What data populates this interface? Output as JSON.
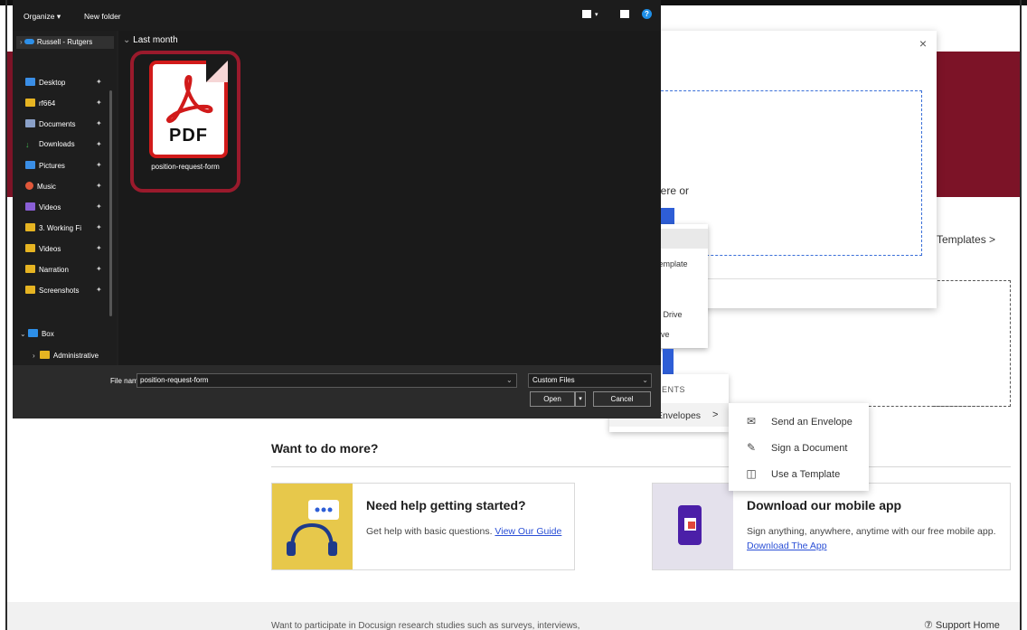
{
  "dialog": {
    "toolbar": {
      "organize_label": "Organize ▾",
      "new_folder_label": "New folder"
    },
    "nav": {
      "top_item": "Russell - Rutgers",
      "quick_access": [
        {
          "label": "Desktop",
          "icon": "desktop-icon",
          "color": "#3a8ee6"
        },
        {
          "label": "rf664",
          "icon": "folder-icon",
          "color": "#e6b422"
        },
        {
          "label": "Documents",
          "icon": "documents-icon",
          "color": "#8aa0c8"
        },
        {
          "label": "Downloads",
          "icon": "downloads-icon",
          "color": "#3fb14f"
        },
        {
          "label": "Pictures",
          "icon": "pictures-icon",
          "color": "#3a8ee6"
        },
        {
          "label": "Music",
          "icon": "music-icon",
          "color": "#e0573a"
        },
        {
          "label": "Videos",
          "icon": "videos-icon",
          "color": "#8a5fd6"
        },
        {
          "label": "3. Working Fi",
          "icon": "folder-icon",
          "color": "#e6b422"
        },
        {
          "label": "Videos",
          "icon": "folder-icon",
          "color": "#e6b422"
        },
        {
          "label": "Narration",
          "icon": "folder-icon",
          "color": "#e6b422"
        },
        {
          "label": "Screenshots",
          "icon": "folder-icon",
          "color": "#e6b422"
        }
      ],
      "box_label": "Box",
      "box_child": "Administrative"
    },
    "group_header": "Last month",
    "file": {
      "name": "position-request-form",
      "icon_text": "PDF"
    },
    "file_name_label": "File name:",
    "file_name_value": "position-request-form",
    "file_type": "Custom Files",
    "open_label": "Open",
    "cancel_label": "Cancel"
  },
  "page": {
    "templates_link": "Templates  >",
    "more_title": "Want to do more?",
    "help_card": {
      "title": "Need help getting started?",
      "text": "Get help with basic questions. ",
      "link": "View Our Guide"
    },
    "app_card": {
      "title": "Download our mobile app",
      "text": "Sign anything, anywhere, anytime with our free mobile app. ",
      "link": "Download The App"
    },
    "footer_text": "Want to participate in Docusign research studies such as surveys, interviews,",
    "support_label": "Support Home"
  },
  "modal": {
    "close_label": "×",
    "drop_text": "here or"
  },
  "upload_menu": [
    "e",
    "template",
    "e Drive",
    "rive"
  ],
  "recents_menu": {
    "label": "ENTS",
    "envelopes": "Envelopes",
    "chevron": ">"
  },
  "sub_menu": [
    {
      "label": "Send an Envelope",
      "icon": "envelope-icon"
    },
    {
      "label": "Sign a Document",
      "icon": "sign-icon"
    },
    {
      "label": "Use a Template",
      "icon": "template-icon"
    }
  ],
  "colors": {
    "hero": "#7c1327",
    "accent": "#2e5ed6",
    "tile_highlight": "#9a1a2c",
    "pdf_red": "#d11a1a"
  }
}
